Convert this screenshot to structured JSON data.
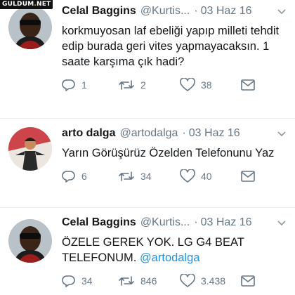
{
  "watermark": {
    "prefix": "GULDUM",
    "dot": ".",
    "suffix": "NET"
  },
  "tweets": [
    {
      "name": "Celal Baggins",
      "handle": "@Kurtis...",
      "separator": "·",
      "date": "03 Haz 16",
      "text": "korkmuyosan laf ebeliği yapıp milleti tehdit edip burada geri vites yapmayacaksın. 1 saate karşıma çık hadi?",
      "mention": "",
      "replies": "1",
      "retweets": "2",
      "likes": "38"
    },
    {
      "name": "arto dalga",
      "handle": "@artodalga",
      "separator": "·",
      "date": "03 Haz 16",
      "text": "Yarın Görüşürüz Özelden Telefonunu Yaz",
      "mention": "",
      "replies": "6",
      "retweets": "34",
      "likes": "40"
    },
    {
      "name": "Celal Baggins",
      "handle": "@Kurtis...",
      "separator": "·",
      "date": "03 Haz 16",
      "text": "ÖZELE GEREK YOK. LG G4 BEAT TELEFONUM.",
      "mention": "@artodalga",
      "replies": "34",
      "retweets": "846",
      "likes": "3.438"
    }
  ],
  "icons": {
    "reply": "reply-icon",
    "retweet": "retweet-icon",
    "like": "heart-icon",
    "message": "envelope-icon",
    "caret": "chevron-down-icon"
  },
  "colors": {
    "secondary": "#657786",
    "link": "#1b95e0",
    "text": "#14171a"
  }
}
